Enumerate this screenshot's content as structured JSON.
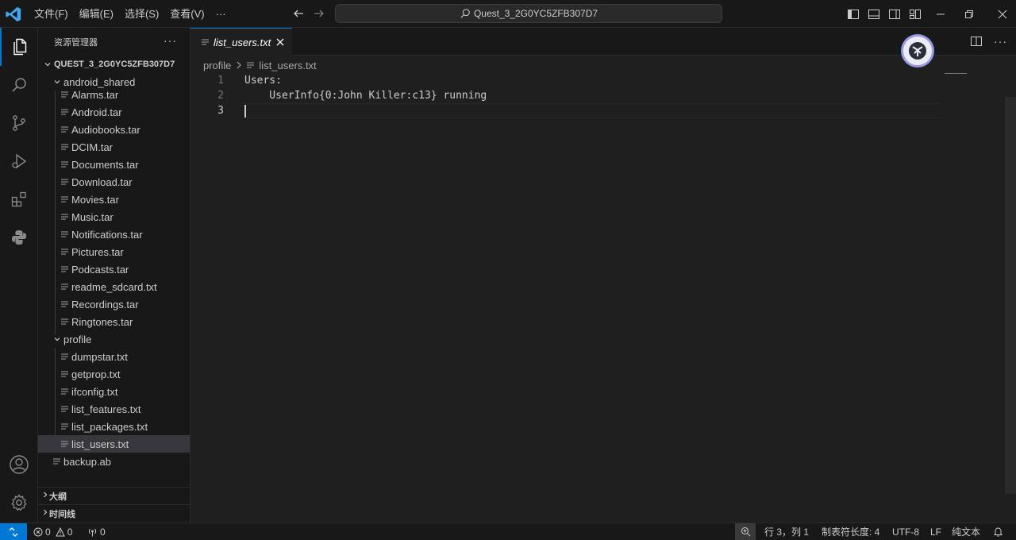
{
  "titlebar": {
    "menu": [
      "文件(F)",
      "编辑(E)",
      "选择(S)",
      "查看(V)",
      "···"
    ],
    "search": "Quest_3_2G0YC5ZFB307D7"
  },
  "sidebar": {
    "header": "资源管理器",
    "more": "···",
    "root": "QUEST_3_2G0YC5ZFB307D7",
    "folder_android": "android_shared",
    "android_files": [
      "Alarms.tar",
      "Android.tar",
      "Audiobooks.tar",
      "DCIM.tar",
      "Documents.tar",
      "Download.tar",
      "Movies.tar",
      "Music.tar",
      "Notifications.tar",
      "Pictures.tar",
      "Podcasts.tar",
      "readme_sdcard.txt",
      "Recordings.tar",
      "Ringtones.tar"
    ],
    "folder_profile": "profile",
    "profile_files": [
      "dumpstar.txt",
      "getprop.txt",
      "ifconfig.txt",
      "list_features.txt",
      "list_packages.txt",
      "list_users.txt"
    ],
    "root_file": "backup.ab",
    "outline": "大纲",
    "timeline": "时间线"
  },
  "editor": {
    "tab_label": "list_users.txt",
    "breadcrumb": [
      "profile",
      "list_users.txt"
    ],
    "lines": [
      {
        "num": "1",
        "text": "Users:"
      },
      {
        "num": "2",
        "text": "    UserInfo{0:John Killer:c13} running"
      },
      {
        "num": "3",
        "text": ""
      }
    ]
  },
  "statusbar": {
    "errors": "0",
    "warnings": "0",
    "ports": "0",
    "position": "行 3，列 1",
    "indent": "制表符长度: 4",
    "encoding": "UTF-8",
    "eol": "LF",
    "language": "纯文本"
  },
  "colors": {
    "accent": "#0078d4",
    "background": "#1f1f1f",
    "sidebar": "#181818",
    "selection": "#37373d"
  }
}
